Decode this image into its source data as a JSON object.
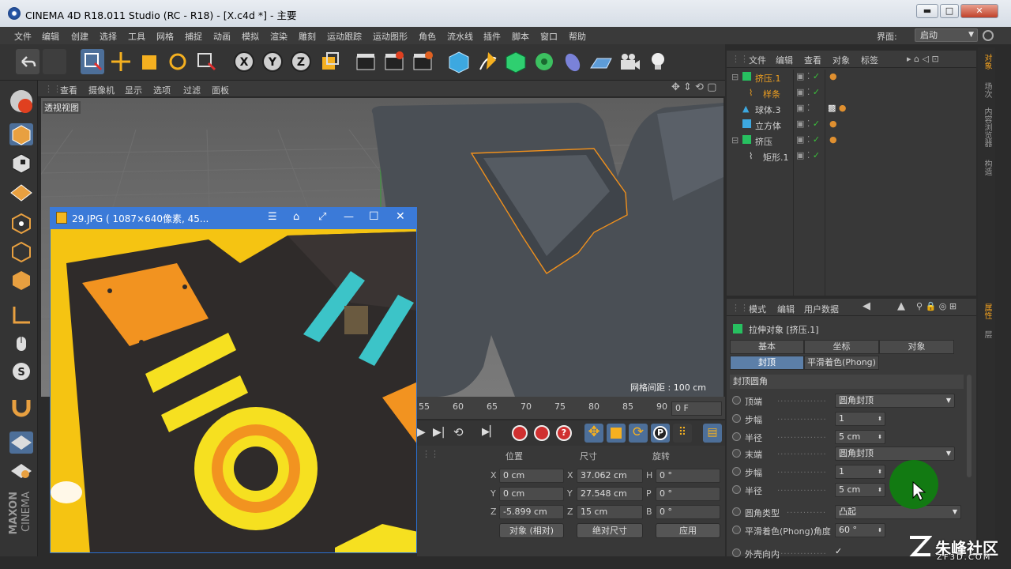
{
  "window": {
    "title": "CINEMA 4D R18.011 Studio (RC - R18) - [X.c4d *] - 主要",
    "min": "▬",
    "max": "□",
    "close": "✕"
  },
  "menu": [
    "文件",
    "编辑",
    "创建",
    "选择",
    "工具",
    "网格",
    "捕捉",
    "动画",
    "模拟",
    "渲染",
    "雕刻",
    "运动跟踪",
    "运动图形",
    "角色",
    "流水线",
    "插件",
    "脚本",
    "窗口",
    "帮助"
  ],
  "layout": {
    "label": "界面:",
    "value": "启动"
  },
  "viewport": {
    "menu": [
      "查看",
      "摄像机",
      "显示",
      "选项",
      "过滤",
      "面板"
    ],
    "label": "透视视图",
    "grid": "网格间距 : 100 cm"
  },
  "timeline": {
    "ticks": [
      "55",
      "60",
      "65",
      "70",
      "75",
      "80",
      "85",
      "90"
    ],
    "frame": "0 F"
  },
  "coords": {
    "headers": [
      "位置",
      "尺寸",
      "旋转"
    ],
    "pos": [
      {
        "axis": "X",
        "val": "0 cm"
      },
      {
        "axis": "Y",
        "val": "0 cm"
      },
      {
        "axis": "Z",
        "val": "-5.899 cm"
      }
    ],
    "size": [
      {
        "axis": "X",
        "val": "37.062 cm"
      },
      {
        "axis": "Y",
        "val": "27.548 cm"
      },
      {
        "axis": "Z",
        "val": "15 cm"
      }
    ],
    "rot": [
      {
        "axis": "H",
        "val": "0 °"
      },
      {
        "axis": "P",
        "val": "0 °"
      },
      {
        "axis": "B",
        "val": "0 °"
      }
    ],
    "mode1": "对象 (相对)",
    "mode2": "绝对尺寸",
    "apply": "应用"
  },
  "objmgr": {
    "menu": [
      "文件",
      "编辑",
      "查看",
      "对象",
      "标签"
    ],
    "rows": [
      {
        "name": "挤压.1",
        "color": "#f0a020"
      },
      {
        "name": "样条",
        "color": "#f0a020"
      },
      {
        "name": "球体.3",
        "color": "#d0d0d0"
      },
      {
        "name": "立方体",
        "color": "#d0d0d0"
      },
      {
        "name": "挤压",
        "color": "#d0d0d0"
      },
      {
        "name": "矩形.1",
        "color": "#d0d0d0"
      }
    ]
  },
  "rightstrip": [
    "对象",
    "场次",
    "内容浏览器",
    "构造",
    "属性",
    "层"
  ],
  "attr": {
    "menu": [
      "模式",
      "编辑",
      "用户数据"
    ],
    "title": "拉伸对象 [挤压.1]",
    "tabs": [
      "基本",
      "坐标",
      "对象",
      "封顶",
      "平滑着色(Phong)"
    ],
    "section": "封顶圆角",
    "rows": [
      {
        "label": "顶端",
        "value": "圆角封顶"
      },
      {
        "label": "步幅",
        "value": "1"
      },
      {
        "label": "半径",
        "value": "5 cm"
      },
      {
        "label": "末端",
        "value": "圆角封顶"
      },
      {
        "label": "步幅",
        "value": "1"
      },
      {
        "label": "半径",
        "value": "5 cm"
      },
      {
        "label": "圆角类型",
        "value": "凸起"
      },
      {
        "label": "平滑着色(Phong)角度",
        "value": "60 °"
      },
      {
        "label": "外壳向内",
        "value": "✓"
      }
    ]
  },
  "imageviewer": {
    "title": "29.JPG ( 1087×640像素, 45..."
  },
  "brand": {
    "maxon": "MAXON",
    "cinema": "CINEMA"
  },
  "watermark": {
    "line1": "朱峰社区",
    "line2": "ZF3D.COM"
  }
}
